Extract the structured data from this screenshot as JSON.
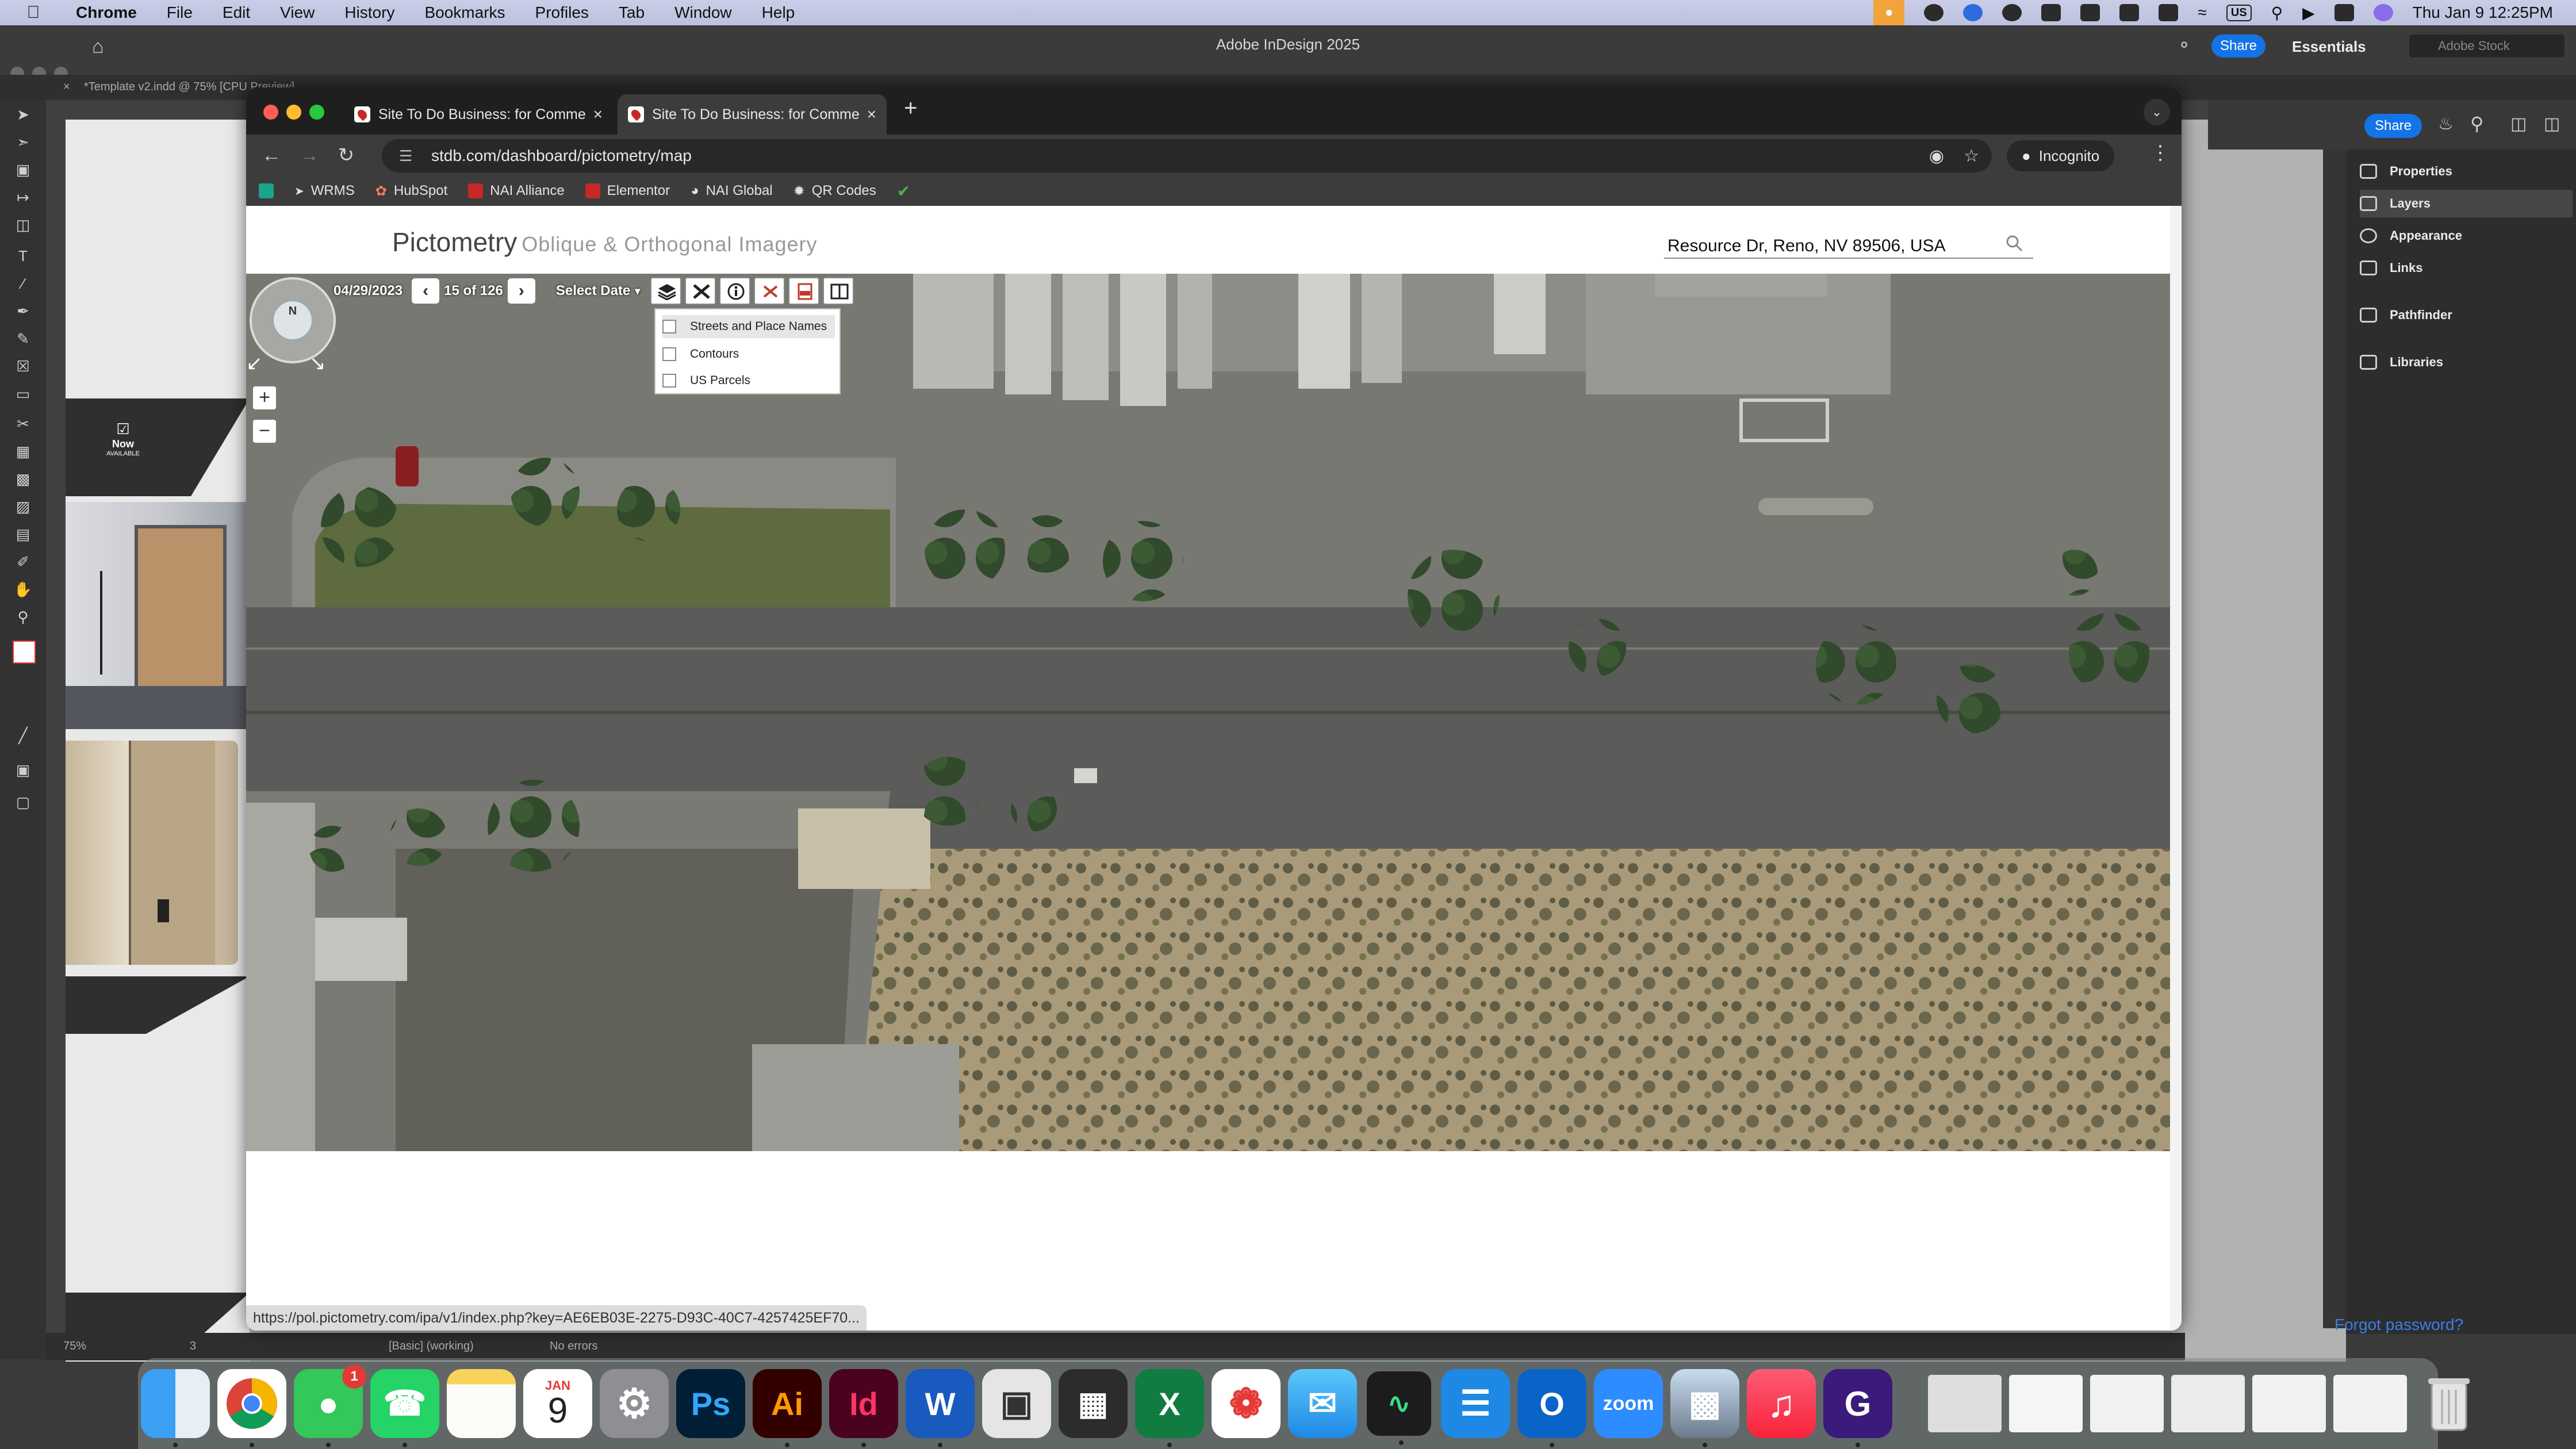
{
  "menubar": {
    "app": "Chrome",
    "items": [
      "File",
      "Edit",
      "View",
      "History",
      "Bookmarks",
      "Profiles",
      "Tab",
      "Window",
      "Help"
    ],
    "input_source": "US",
    "datetime": "Thu Jan 9  12:25PM"
  },
  "indesign": {
    "title": "Adobe InDesign 2025",
    "doc_tab": "*Template v2.indd @ 75% [CPU Preview]",
    "share": "Share",
    "workspace": "Essentials",
    "stock_search": "Adobe Stock",
    "share2": "Share",
    "panel": [
      "Properties",
      "Layers",
      "Appearance",
      "Links",
      "Pathfinder",
      "Libraries"
    ],
    "page_label": "Now",
    "page_sub": "AVAILABLE",
    "zoom": "75%",
    "page_num": "3",
    "preflight_profile": "[Basic] (working)",
    "errors": "No errors",
    "forgot": "Forgot password?"
  },
  "chrome": {
    "tabs": [
      {
        "title": "Site To Do Business: for Commercial Real Estate"
      },
      {
        "title": "Site To Do Business: for Commercial Real Estate"
      }
    ],
    "url": "stdb.com/dashboard/pictometry/map",
    "incognito": "Incognito",
    "bookmarks": [
      "WRMS",
      "HubSpot",
      "NAI Alliance",
      "Elementor",
      "NAI Global",
      "QR Codes"
    ],
    "status_url": "https://pol.pictometry.com/ipa/v1/index.php?key=AE6EB03E-2275-D93C-40C7-4257425EF70..."
  },
  "pictometry": {
    "brand": "Pictometry",
    "subtitle": "Oblique & Orthogonal Imagery",
    "address": "Resource Dr, Reno, NV 89506, USA",
    "date": "04/29/2023",
    "counter": "15 of 126",
    "select_date": "Select Date",
    "compass": "N",
    "layers": [
      "Streets and Place Names",
      "Contours",
      "US Parcels"
    ]
  },
  "dock": {
    "messages_badge": "1",
    "calendar_month": "JAN",
    "calendar_day": "9",
    "apps": {
      "ps": "Ps",
      "ai": "Ai",
      "id": "Id",
      "zoom": "zoom"
    }
  }
}
